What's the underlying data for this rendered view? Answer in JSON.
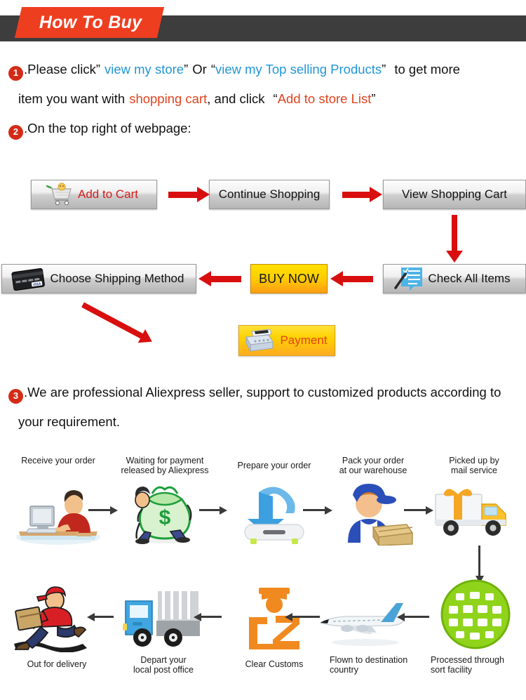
{
  "header": {
    "title": "How To Buy",
    "tag_color": "#ee3e20",
    "bar_color": "#3d3d3d"
  },
  "steps": [
    {
      "number": "1",
      "segments": [
        {
          "text": ".Please click",
          "color": "black"
        },
        {
          "text": "”",
          "color": "black"
        },
        {
          "text": "view my store",
          "color": "blue"
        },
        {
          "text": "”",
          "color": "black"
        },
        {
          "text": "Or",
          "color": "black"
        },
        {
          "text": "“",
          "color": "black"
        },
        {
          "text": "view my Top selling Products",
          "color": "blue"
        },
        {
          "text": "”",
          "color": "black"
        },
        {
          "text": "to get more",
          "color": "black"
        }
      ]
    },
    {
      "number": "",
      "segments": [
        {
          "text": "item you want with",
          "color": "black"
        },
        {
          "text": "shopping cart",
          "color": "red"
        },
        {
          "text": ", and click",
          "color": "black"
        },
        {
          "text": "“",
          "color": "black"
        },
        {
          "text": "Add to store List",
          "color": "red"
        },
        {
          "text": "”",
          "color": "black"
        }
      ]
    },
    {
      "number": "2",
      "segments": [
        {
          "text": ".On the top right of webpage:",
          "color": "black"
        }
      ]
    }
  ],
  "step3": {
    "number": "3",
    "line1": ".We are professional Aliexpress seller, support to customized products according to",
    "line2": "your requirement."
  },
  "flow": {
    "buttons": [
      {
        "id": "add-cart",
        "label": "Add to Cart",
        "icon": "shopping-cart-icon",
        "style": "gray",
        "text_color": "#d61a1a"
      },
      {
        "id": "continue",
        "label": "Continue Shopping",
        "icon": "",
        "style": "gray",
        "text_color": "#111111"
      },
      {
        "id": "view-cart",
        "label": "View Shopping Cart",
        "icon": "",
        "style": "gray",
        "text_color": "#111111"
      },
      {
        "id": "shipping",
        "label": "Choose Shipping Method",
        "icon": "credit-card-icon",
        "style": "gray",
        "text_color": "#111111"
      },
      {
        "id": "buynow",
        "label": "BUY NOW",
        "icon": "",
        "style": "orange",
        "text_color": "#151515"
      },
      {
        "id": "check",
        "label": "Check All Items",
        "icon": "checklist-icon",
        "style": "gray",
        "text_color": "#111111"
      },
      {
        "id": "payment",
        "label": "Payment",
        "icon": "cash-register-icon",
        "style": "yellow",
        "text_color": "#e8401a"
      }
    ],
    "arrow_color": "#d90f0f"
  },
  "shipping_process": {
    "arrow_color": "#3a3a3a",
    "top_row": [
      {
        "caption_line1": "Receive your order",
        "caption_line2": "",
        "icon": "person-at-computer-icon"
      },
      {
        "caption_line1": "Waiting for payment",
        "caption_line2": "released by Aliexpress",
        "icon": "money-bag-icon"
      },
      {
        "caption_line1": "Prepare your order",
        "caption_line2": "",
        "icon": "download-arrow-icon"
      },
      {
        "caption_line1": "Pack your order",
        "caption_line2": "at our warehouse",
        "icon": "warehouse-worker-icon"
      },
      {
        "caption_line1": "Picked up by",
        "caption_line2": "mail service",
        "icon": "delivery-truck-icon"
      }
    ],
    "bottom_row": [
      {
        "caption_line1": "Out for delivery",
        "caption_line2": "",
        "icon": "running-courier-icon"
      },
      {
        "caption_line1": "Depart your",
        "caption_line2": "local post office",
        "icon": "blue-truck-icon"
      },
      {
        "caption_line1": "Clear Customs",
        "caption_line2": "",
        "icon": "customs-officer-icon"
      },
      {
        "caption_line1": "Flown to destination",
        "caption_line2": "country",
        "icon": "airplane-icon"
      },
      {
        "caption_line1": "Processed through",
        "caption_line2": "sort facility",
        "icon": "green-globe-icon"
      }
    ]
  }
}
